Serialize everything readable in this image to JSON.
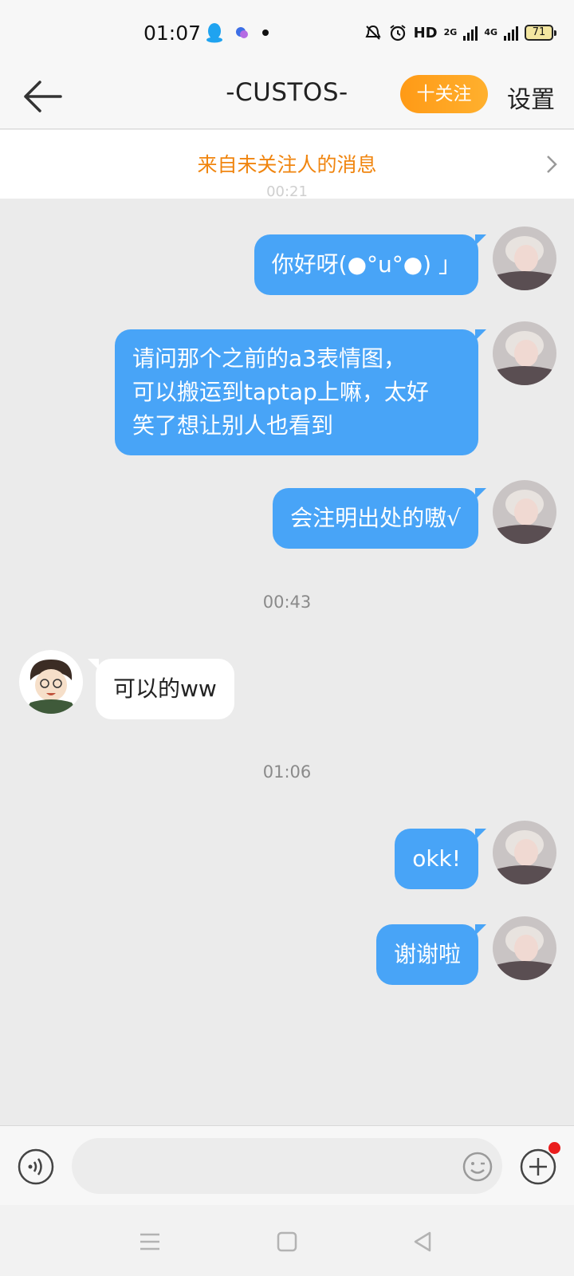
{
  "status_bar": {
    "time": "01:07",
    "left_icons": [
      "qq-penguin-icon",
      "app-swirl-icon",
      "dot-icon"
    ],
    "right_icons": [
      "mute-bell-icon",
      "alarm-icon"
    ],
    "hd": "HD",
    "signal_2g": "2G",
    "signal_4g": "4G",
    "battery": "71"
  },
  "header": {
    "title": "-CUSTOS-",
    "follow_label": "十关注",
    "settings_label": "设置"
  },
  "notice": {
    "text": "来自未关注人的消息",
    "hidden_time": "00:21"
  },
  "messages": [
    {
      "side": "out",
      "text": "你好呀(●°u°●) 」"
    },
    {
      "side": "out",
      "text": "请问那个之前的a3表情图，\n可以搬运到taptap上嘛，太好\n笑了想让别人也看到"
    },
    {
      "side": "out",
      "text": "会注明出处的嗷√"
    },
    {
      "side": "time",
      "text": "00:43"
    },
    {
      "side": "in",
      "text": "可以的ww"
    },
    {
      "side": "time",
      "text": "01:06"
    },
    {
      "side": "out",
      "text": "okk!"
    },
    {
      "side": "out",
      "text": "谢谢啦"
    }
  ],
  "input": {
    "placeholder": ""
  },
  "colors": {
    "accent_orange": "#ff9a16",
    "bubble_blue": "#48a4f7",
    "notice_orange": "#f0850f",
    "chat_bg": "#ebebeb"
  }
}
